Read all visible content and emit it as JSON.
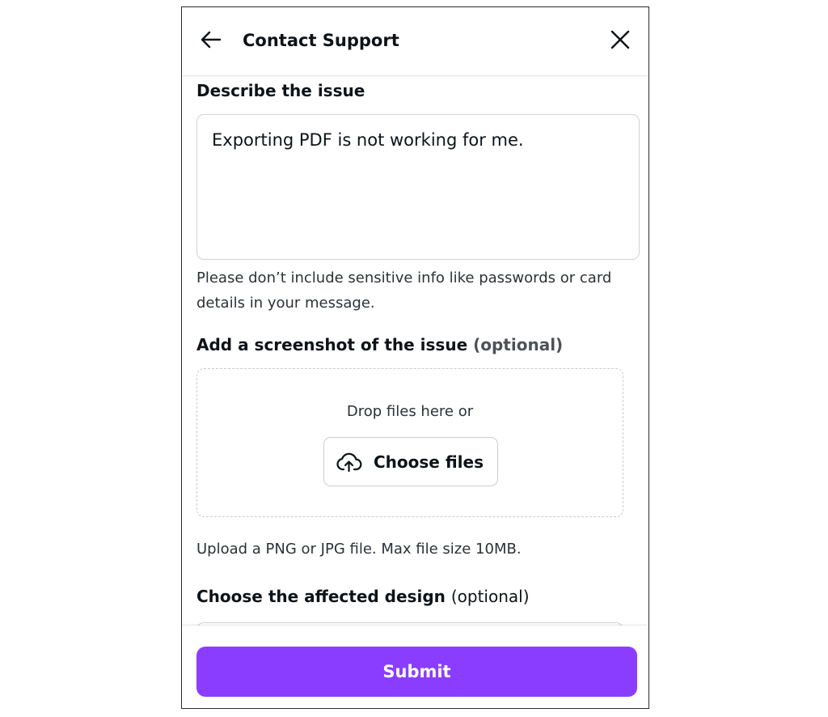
{
  "header": {
    "title": "Contact Support",
    "back_icon": "arrow-left-icon",
    "close_icon": "close-icon"
  },
  "issue": {
    "label": "Describe the issue",
    "value": "Exporting PDF is not working for me.",
    "helper": "Please don’t include sensitive info like passwords or card details in your message."
  },
  "screenshot": {
    "label": "Add a screenshot of the issue",
    "optional": "(optional)",
    "drop_text": "Drop files here or",
    "choose_label": "Choose files",
    "upload_icon": "cloud-upload-icon",
    "helper": "Upload a PNG or JPG file. Max file size 10MB."
  },
  "design": {
    "label": "Choose the affected design",
    "optional": "(optional)"
  },
  "footer": {
    "submit_label": "Submit"
  },
  "colors": {
    "accent": "#8b3dff",
    "text": "#0e1318",
    "border": "#d1d3d6"
  }
}
